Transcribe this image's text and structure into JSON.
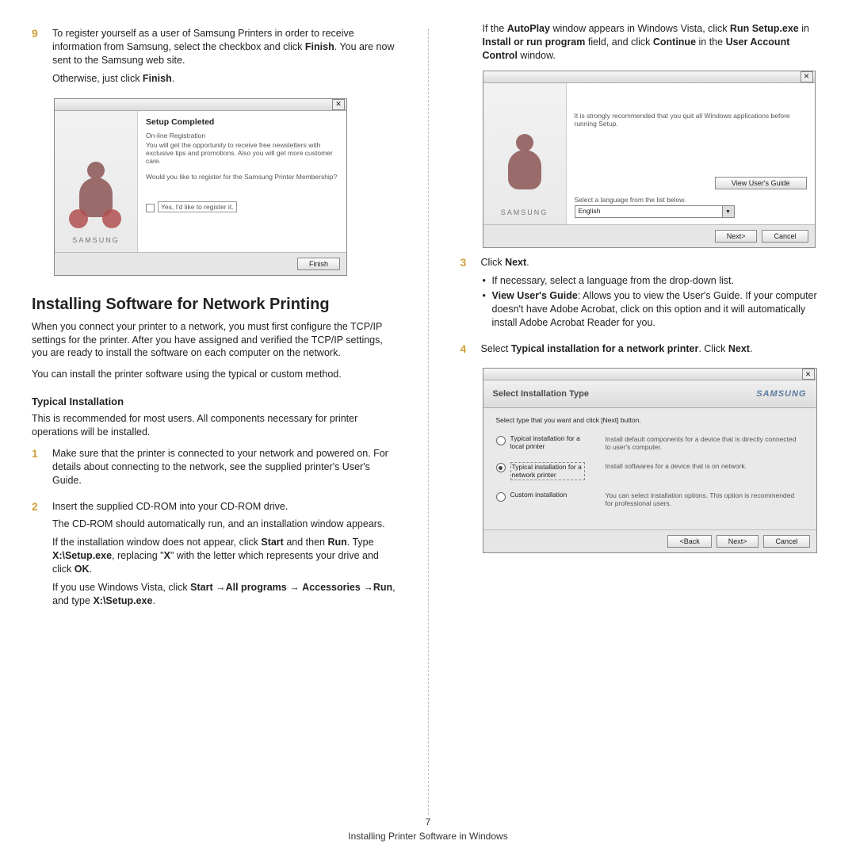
{
  "page": {
    "number": "7",
    "footer": "Installing Printer Software in Windows"
  },
  "left": {
    "step9_num": "9",
    "step9_p1a": "To register yourself as a user of Samsung Printers in order to receive information from Samsung, select the checkbox and click ",
    "step9_p1b": "Finish",
    "step9_p1c": ". You are now sent to the Samsung web site.",
    "step9_p2a": "Otherwise, just click ",
    "step9_p2b": "Finish",
    "step9_p2c": ".",
    "section_title": "Installing Software for Network Printing",
    "para1": "When you connect your printer to a network, you must first configure the TCP/IP settings for the printer. After you have assigned and verified the TCP/IP settings, you are ready to install the software on each computer on the network.",
    "para2": "You can install the printer software using the typical or custom method.",
    "sub_title": "Typical Installation",
    "sub_para": "This is recommended for most users. All components necessary for printer operations will be installed.",
    "step1_num": "1",
    "step1_p": "Make sure that the printer is connected to your network and powered on. For details about connecting to the network, see the supplied printer's User's Guide.",
    "step2_num": "2",
    "step2_p1": "Insert the supplied CD-ROM into your CD-ROM drive.",
    "step2_p2": "The CD-ROM should automatically run, and an installation window appears.",
    "step2_p3a": "If the installation window does not appear, click ",
    "step2_p3b": "Start",
    "step2_p3c": " and then ",
    "step2_p3d": "Run",
    "step2_p3e": ". Type ",
    "step2_p3f": "X:\\Setup.exe",
    "step2_p3g": ", replacing \"",
    "step2_p3h": "X",
    "step2_p3i": "\" with the letter which represents your drive and click ",
    "step2_p3j": "OK",
    "step2_p3k": ".",
    "step2_p4a": "If you use Windows Vista, click ",
    "step2_p4b": "Start",
    "step2_p4c": " →",
    "step2_p4d": "All programs",
    "step2_p4e": " → ",
    "step2_p4f": "Accessories",
    "step2_p4g": " →",
    "step2_p4h": "Run",
    "step2_p4i": ", and type ",
    "step2_p4j": "X:\\Setup.exe",
    "step2_p4k": "."
  },
  "right": {
    "pvista_a": "If the ",
    "pvista_b": "AutoPlay",
    "pvista_c": " window appears in Windows Vista, click ",
    "pvista_d": "Run Setup.exe",
    "pvista_e": " in ",
    "pvista_f": "Install or run program",
    "pvista_g": " field, and click ",
    "pvista_h": "Continue",
    "pvista_i": " in the ",
    "pvista_j": "User Account Control",
    "pvista_k": " window.",
    "step3_num": "3",
    "step3_p1a": "Click ",
    "step3_p1b": "Next",
    "step3_p1c": ".",
    "step3_b1": "If necessary, select a language from the drop-down list.",
    "step3_b2a": "View User's Guide",
    "step3_b2b": ": Allows you to view the User's Guide. If your computer doesn't have Adobe Acrobat, click on this option and it will automatically install Adobe Acrobat Reader for you.",
    "step4_num": "4",
    "step4_p1a": "Select ",
    "step4_p1b": "Typical installation for a network printer",
    "step4_p1c": ". Click ",
    "step4_p1d": "Next",
    "step4_p1e": "."
  },
  "mock1": {
    "title": "Setup Completed",
    "reg_title": "On-line Registration",
    "reg_line1": "You will get the opportunity to receive free newsletters with exclusive tips and promotions. Also you will get more customer care.",
    "reg_q": "Would you like to register for the Samsung Printer Membership?",
    "checkbox_label": "Yes, I'd like to register it.",
    "samsung": "SAMSUNG",
    "finish": "Finish"
  },
  "mock2": {
    "recommend": "It is strongly recommended that you quit all Windows applications before running Setup.",
    "view_guide": "View User's Guide",
    "select_lang": "Select a language from the list below.",
    "lang": "English",
    "samsung": "SAMSUNG",
    "next": "Next>",
    "cancel": "Cancel"
  },
  "mock3": {
    "hdr_title": "Select Installation Type",
    "logo": "SAMSUNG",
    "instr": "Select type that you want and click [Next] button.",
    "opt1_label": "Typical installation for a local printer",
    "opt1_desc": "Install default components for a device that is directly connected to user's computer.",
    "opt2_label": "Typical installation for a network printer",
    "opt2_desc": "Install softwares for a device that is on network.",
    "opt3_label": "Custom installation",
    "opt3_desc": "You can select installation options. This option is recommended for professional users.",
    "back": "<Back",
    "next": "Next>",
    "cancel": "Cancel"
  }
}
